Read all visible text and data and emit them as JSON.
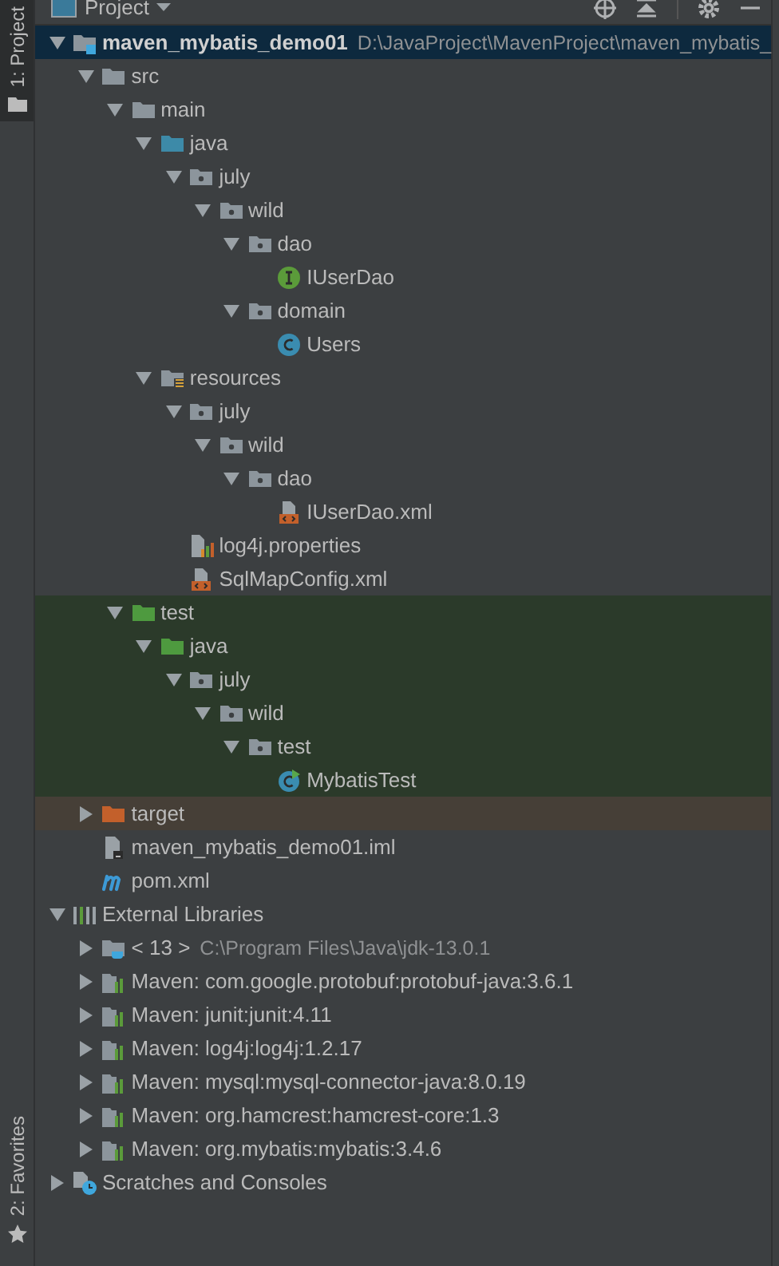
{
  "side_tabs": [
    {
      "label": "1: Project",
      "kind": "project",
      "selected": true
    },
    {
      "label": "2: Favorites",
      "kind": "favorites",
      "selected": false
    }
  ],
  "header": {
    "title": "Project"
  },
  "tree": [
    {
      "label": "maven_mybatis_demo01",
      "detail": "D:\\JavaProject\\MavenProject\\maven_mybatis_",
      "kind": "module",
      "expanded": true,
      "selected": true,
      "children": [
        {
          "label": "src",
          "kind": "folder",
          "expanded": true,
          "selected": false,
          "children": [
            {
              "label": "main",
              "kind": "folder",
              "expanded": true,
              "selected": false,
              "children": [
                {
                  "label": "java",
                  "kind": "source_folder",
                  "expanded": true,
                  "selected": false,
                  "children": [
                    {
                      "label": "july",
                      "kind": "package",
                      "expanded": true,
                      "selected": false,
                      "children": [
                        {
                          "label": "wild",
                          "kind": "package",
                          "expanded": true,
                          "selected": false,
                          "children": [
                            {
                              "label": "dao",
                              "kind": "package",
                              "expanded": true,
                              "selected": false,
                              "children": [
                                {
                                  "label": "IUserDao",
                                  "kind": "interface",
                                  "selected": false
                                }
                              ]
                            },
                            {
                              "label": "domain",
                              "kind": "package",
                              "expanded": true,
                              "selected": false,
                              "children": [
                                {
                                  "label": "Users",
                                  "kind": "class",
                                  "selected": false
                                }
                              ]
                            }
                          ]
                        }
                      ]
                    }
                  ]
                },
                {
                  "label": "resources",
                  "kind": "resources_folder",
                  "expanded": true,
                  "selected": false,
                  "children": [
                    {
                      "label": "july",
                      "kind": "package",
                      "expanded": true,
                      "selected": false,
                      "children": [
                        {
                          "label": "wild",
                          "kind": "package",
                          "expanded": true,
                          "selected": false,
                          "children": [
                            {
                              "label": "dao",
                              "kind": "package",
                              "expanded": true,
                              "selected": false,
                              "children": [
                                {
                                  "label": "IUserDao.xml",
                                  "kind": "xml_file",
                                  "selected": false
                                }
                              ]
                            }
                          ]
                        }
                      ]
                    },
                    {
                      "label": "log4j.properties",
                      "kind": "properties_file",
                      "selected": false
                    },
                    {
                      "label": "SqlMapConfig.xml",
                      "kind": "xml_file",
                      "selected": false
                    }
                  ]
                }
              ]
            },
            {
              "label": "test",
              "kind": "test_folder",
              "expanded": true,
              "selected": false,
              "color": "#2b3a2a",
              "children": [
                {
                  "label": "java",
                  "kind": "test_folder",
                  "expanded": true,
                  "selected": false,
                  "color": "#2b3a2a",
                  "children": [
                    {
                      "label": "july",
                      "kind": "package",
                      "expanded": true,
                      "selected": false,
                      "color": "#2b3a2a",
                      "children": [
                        {
                          "label": "wild",
                          "kind": "package",
                          "expanded": true,
                          "selected": false,
                          "color": "#2b3a2a",
                          "children": [
                            {
                              "label": "test",
                              "kind": "package",
                              "expanded": true,
                              "selected": false,
                              "color": "#2b3a2a",
                              "children": [
                                {
                                  "label": "MybatisTest",
                                  "kind": "test_class",
                                  "selected": false,
                                  "color": "#2b3a2a"
                                }
                              ]
                            }
                          ]
                        }
                      ]
                    }
                  ]
                }
              ]
            }
          ]
        },
        {
          "label": "target",
          "kind": "excluded_folder",
          "expanded": false,
          "selected": false,
          "color": "#463f37"
        },
        {
          "label": "maven_mybatis_demo01.iml",
          "kind": "iml_file",
          "selected": false
        },
        {
          "label": "pom.xml",
          "kind": "maven_file",
          "selected": false
        }
      ]
    },
    {
      "label": "External Libraries",
      "kind": "libraries",
      "expanded": true,
      "selected": false,
      "children": [
        {
          "label": "< 13 >",
          "detail": "C:\\Program Files\\Java\\jdk-13.0.1",
          "kind": "jdk",
          "expanded": false,
          "selected": false
        },
        {
          "label": "Maven: com.google.protobuf:protobuf-java:3.6.1",
          "kind": "maven_library",
          "expanded": false,
          "selected": false
        },
        {
          "label": "Maven: junit:junit:4.11",
          "kind": "maven_library",
          "expanded": false,
          "selected": false
        },
        {
          "label": "Maven: log4j:log4j:1.2.17",
          "kind": "maven_library",
          "expanded": false,
          "selected": false
        },
        {
          "label": "Maven: mysql:mysql-connector-java:8.0.19",
          "kind": "maven_library",
          "expanded": false,
          "selected": false
        },
        {
          "label": "Maven: org.hamcrest:hamcrest-core:1.3",
          "kind": "maven_library",
          "expanded": false,
          "selected": false
        },
        {
          "label": "Maven: org.mybatis:mybatis:3.4.6",
          "kind": "maven_library",
          "expanded": false,
          "selected": false
        }
      ]
    },
    {
      "label": "Scratches and Consoles",
      "kind": "scratches",
      "expanded": false,
      "selected": false
    }
  ]
}
